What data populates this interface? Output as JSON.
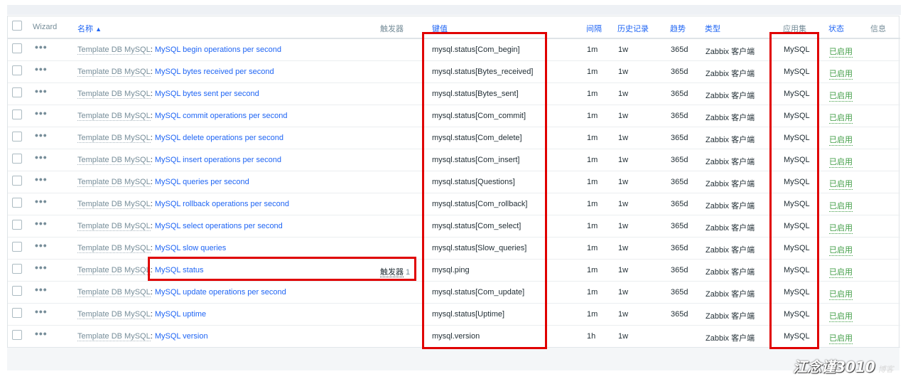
{
  "header": {
    "wizard": "Wizard",
    "name": "名称",
    "sort_arrow": "▲",
    "triggers": "触发器",
    "key": "键值",
    "interval": "间隔",
    "history": "历史记录",
    "trends": "趋势",
    "type": "类型",
    "application": "应用集",
    "status": "状态",
    "info": "信息"
  },
  "rows": [
    {
      "template": "Template DB MySQL",
      "sep": ": ",
      "name": "MySQL begin operations per second",
      "trigger": "",
      "trigger_count": "",
      "key": "mysql.status[Com_begin]",
      "interval": "1m",
      "history": "1w",
      "trends": "365d",
      "type": "Zabbix 客户端",
      "app": "MySQL",
      "status": "已启用"
    },
    {
      "template": "Template DB MySQL",
      "sep": ": ",
      "name": "MySQL bytes received per second",
      "trigger": "",
      "trigger_count": "",
      "key": "mysql.status[Bytes_received]",
      "interval": "1m",
      "history": "1w",
      "trends": "365d",
      "type": "Zabbix 客户端",
      "app": "MySQL",
      "status": "已启用"
    },
    {
      "template": "Template DB MySQL",
      "sep": ": ",
      "name": "MySQL bytes sent per second",
      "trigger": "",
      "trigger_count": "",
      "key": "mysql.status[Bytes_sent]",
      "interval": "1m",
      "history": "1w",
      "trends": "365d",
      "type": "Zabbix 客户端",
      "app": "MySQL",
      "status": "已启用"
    },
    {
      "template": "Template DB MySQL",
      "sep": ": ",
      "name": "MySQL commit operations per second",
      "trigger": "",
      "trigger_count": "",
      "key": "mysql.status[Com_commit]",
      "interval": "1m",
      "history": "1w",
      "trends": "365d",
      "type": "Zabbix 客户端",
      "app": "MySQL",
      "status": "已启用"
    },
    {
      "template": "Template DB MySQL",
      "sep": ": ",
      "name": "MySQL delete operations per second",
      "trigger": "",
      "trigger_count": "",
      "key": "mysql.status[Com_delete]",
      "interval": "1m",
      "history": "1w",
      "trends": "365d",
      "type": "Zabbix 客户端",
      "app": "MySQL",
      "status": "已启用"
    },
    {
      "template": "Template DB MySQL",
      "sep": ": ",
      "name": "MySQL insert operations per second",
      "trigger": "",
      "trigger_count": "",
      "key": "mysql.status[Com_insert]",
      "interval": "1m",
      "history": "1w",
      "trends": "365d",
      "type": "Zabbix 客户端",
      "app": "MySQL",
      "status": "已启用"
    },
    {
      "template": "Template DB MySQL",
      "sep": ": ",
      "name": "MySQL queries per second",
      "trigger": "",
      "trigger_count": "",
      "key": "mysql.status[Questions]",
      "interval": "1m",
      "history": "1w",
      "trends": "365d",
      "type": "Zabbix 客户端",
      "app": "MySQL",
      "status": "已启用"
    },
    {
      "template": "Template DB MySQL",
      "sep": ": ",
      "name": "MySQL rollback operations per second",
      "trigger": "",
      "trigger_count": "",
      "key": "mysql.status[Com_rollback]",
      "interval": "1m",
      "history": "1w",
      "trends": "365d",
      "type": "Zabbix 客户端",
      "app": "MySQL",
      "status": "已启用"
    },
    {
      "template": "Template DB MySQL",
      "sep": ": ",
      "name": "MySQL select operations per second",
      "trigger": "",
      "trigger_count": "",
      "key": "mysql.status[Com_select]",
      "interval": "1m",
      "history": "1w",
      "trends": "365d",
      "type": "Zabbix 客户端",
      "app": "MySQL",
      "status": "已启用"
    },
    {
      "template": "Template DB MySQL",
      "sep": ": ",
      "name": "MySQL slow queries",
      "trigger": "",
      "trigger_count": "",
      "key": "mysql.status[Slow_queries]",
      "interval": "1m",
      "history": "1w",
      "trends": "365d",
      "type": "Zabbix 客户端",
      "app": "MySQL",
      "status": "已启用"
    },
    {
      "template": "Template DB MySQL",
      "sep": ": ",
      "name": "MySQL status",
      "trigger": "触发器",
      "trigger_count": "1",
      "key": "mysql.ping",
      "interval": "1m",
      "history": "1w",
      "trends": "365d",
      "type": "Zabbix 客户端",
      "app": "MySQL",
      "status": "已启用"
    },
    {
      "template": "Template DB MySQL",
      "sep": ": ",
      "name": "MySQL update operations per second",
      "trigger": "",
      "trigger_count": "",
      "key": "mysql.status[Com_update]",
      "interval": "1m",
      "history": "1w",
      "trends": "365d",
      "type": "Zabbix 客户端",
      "app": "MySQL",
      "status": "已启用"
    },
    {
      "template": "Template DB MySQL",
      "sep": ": ",
      "name": "MySQL uptime",
      "trigger": "",
      "trigger_count": "",
      "key": "mysql.status[Uptime]",
      "interval": "1m",
      "history": "1w",
      "trends": "365d",
      "type": "Zabbix 客户端",
      "app": "MySQL",
      "status": "已启用"
    },
    {
      "template": "Template DB MySQL",
      "sep": ": ",
      "name": "MySQL version",
      "trigger": "",
      "trigger_count": "",
      "key": "mysql.version",
      "interval": "1h",
      "history": "1w",
      "trends": "",
      "type": "Zabbix 客户端",
      "app": "MySQL",
      "status": "已启用"
    }
  ],
  "watermark": {
    "main": "江念谨3010",
    "sub": "博客"
  },
  "colors": {
    "link": "#1f65f4",
    "status_enabled": "#429e47",
    "highlight": "#e00000",
    "muted": "#768d99"
  }
}
